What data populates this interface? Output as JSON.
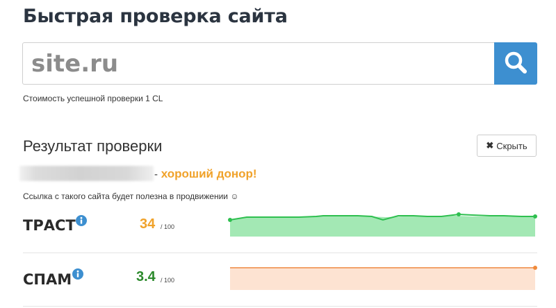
{
  "page": {
    "title": "Быстрая проверка сайта"
  },
  "search": {
    "placeholder": "site.ru",
    "value": ""
  },
  "search_button": {
    "icon": "search-icon"
  },
  "cost_note": "Стоимость успешной проверки 1 CL",
  "result": {
    "heading": "Результат проверки",
    "hide_button_icon": "close-icon",
    "hide_button_label": "Скрыть",
    "verdict_dash": "-",
    "verdict": "хороший донор!",
    "note": "Ссылка с такого сайта будет полезна в продвижении ☺"
  },
  "metrics": {
    "trust": {
      "label": "ТРАСТ",
      "icon": "info-icon",
      "value": "34",
      "max": "/ 100",
      "color": "#f0a22a",
      "chart_color_line": "#2ebf4f",
      "chart_color_fill": "#a3e8b4"
    },
    "spam": {
      "label": "СПАМ",
      "icon": "info-icon",
      "value": "3.4",
      "max": "/ 100",
      "color": "#2c8a2c",
      "chart_color_line": "#f2a26a",
      "chart_color_fill": "#fde3d2"
    }
  }
}
